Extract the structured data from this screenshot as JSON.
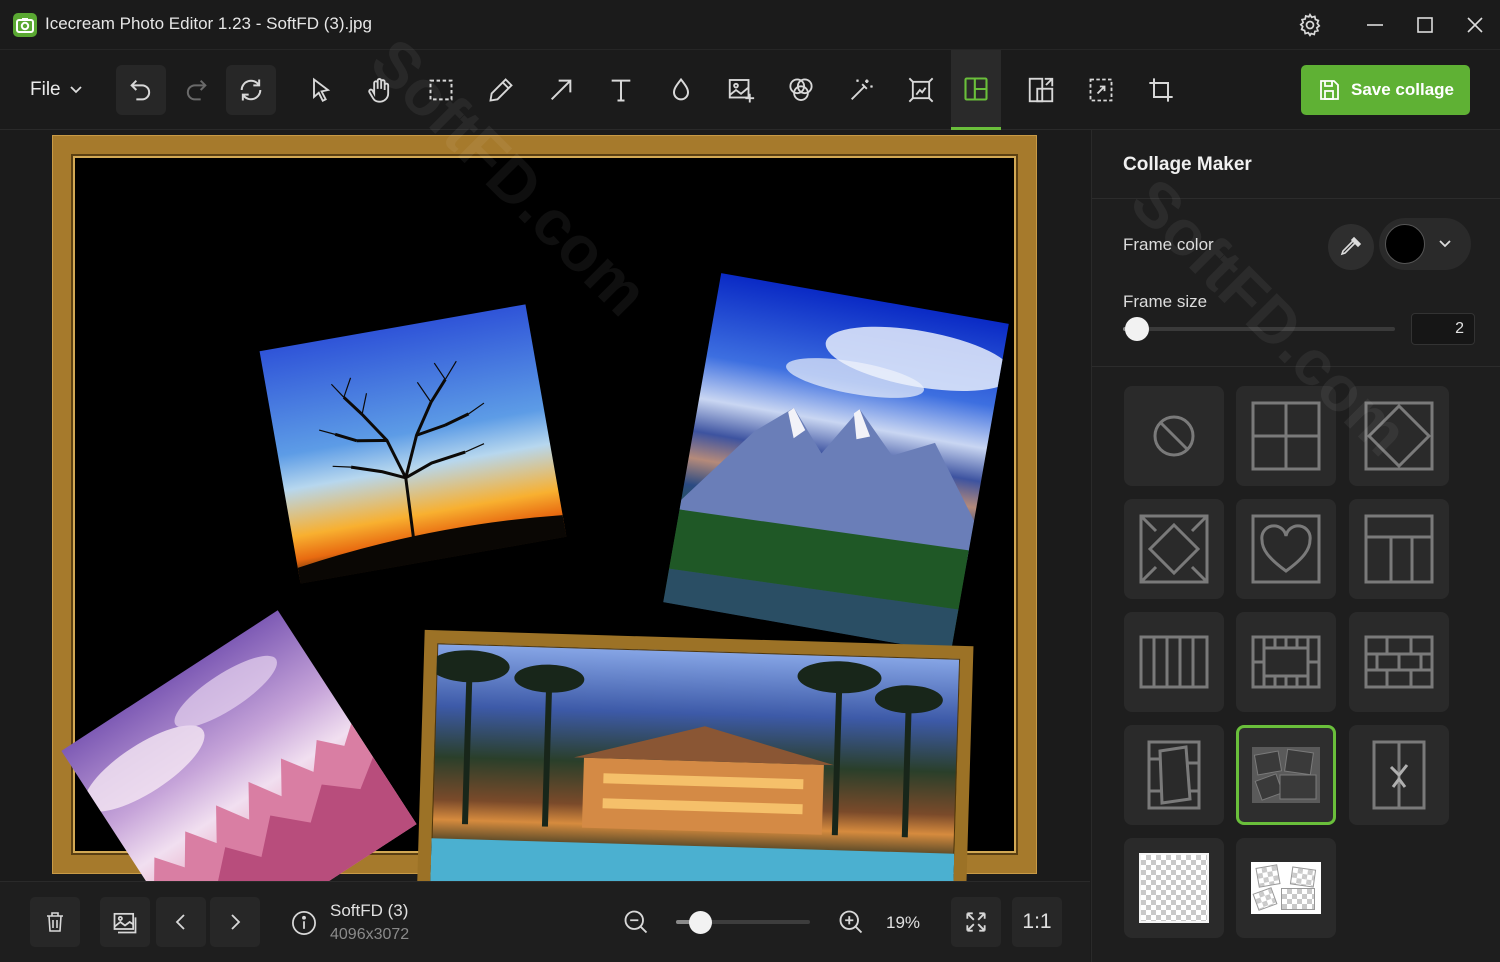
{
  "window": {
    "title": "Icecream Photo Editor 1.23 - SoftFD (3).jpg",
    "icons": [
      "settings-icon",
      "minimize-icon",
      "maximize-icon",
      "close-icon"
    ]
  },
  "toolbar": {
    "file_label": "File",
    "tools": [
      "undo",
      "redo",
      "reset",
      "select",
      "pan",
      "rectangle-select",
      "pencil",
      "arrow",
      "text",
      "blur",
      "add-image",
      "filters",
      "magic-wand",
      "resize",
      "collage",
      "export",
      "crop-fit",
      "crop"
    ],
    "active_tool": "collage",
    "save_label": "Save collage",
    "accent_color": "#5fb134"
  },
  "canvas": {
    "photos": [
      "tree-sunset",
      "mountain-lake",
      "pink-snow-forest",
      "tropical-resort"
    ],
    "frame_style": "gold-ornate"
  },
  "bottom": {
    "file_name": "SoftFD (3)",
    "file_dims": "4096x3072",
    "zoom_fraction": 0.18,
    "zoom_label": "19%",
    "one_to_one_label": "1:1"
  },
  "panel": {
    "title": "Collage Maker",
    "frame_color_label": "Frame color",
    "frame_color": "#000000",
    "frame_size_label": "Frame size",
    "frame_size_value": "2",
    "frame_size_fraction": 0.05,
    "templates": [
      "none",
      "grid-2x2",
      "diamond",
      "diamond-corners",
      "heart",
      "t-layout",
      "vertical-strips",
      "film-frame",
      "brick",
      "scattered-rects",
      "polaroid-scatter",
      "torn-pieces",
      "custom-checker-1",
      "custom-checker-2"
    ],
    "selected_template": "polaroid-scatter"
  },
  "watermark": "SoftFD.com"
}
